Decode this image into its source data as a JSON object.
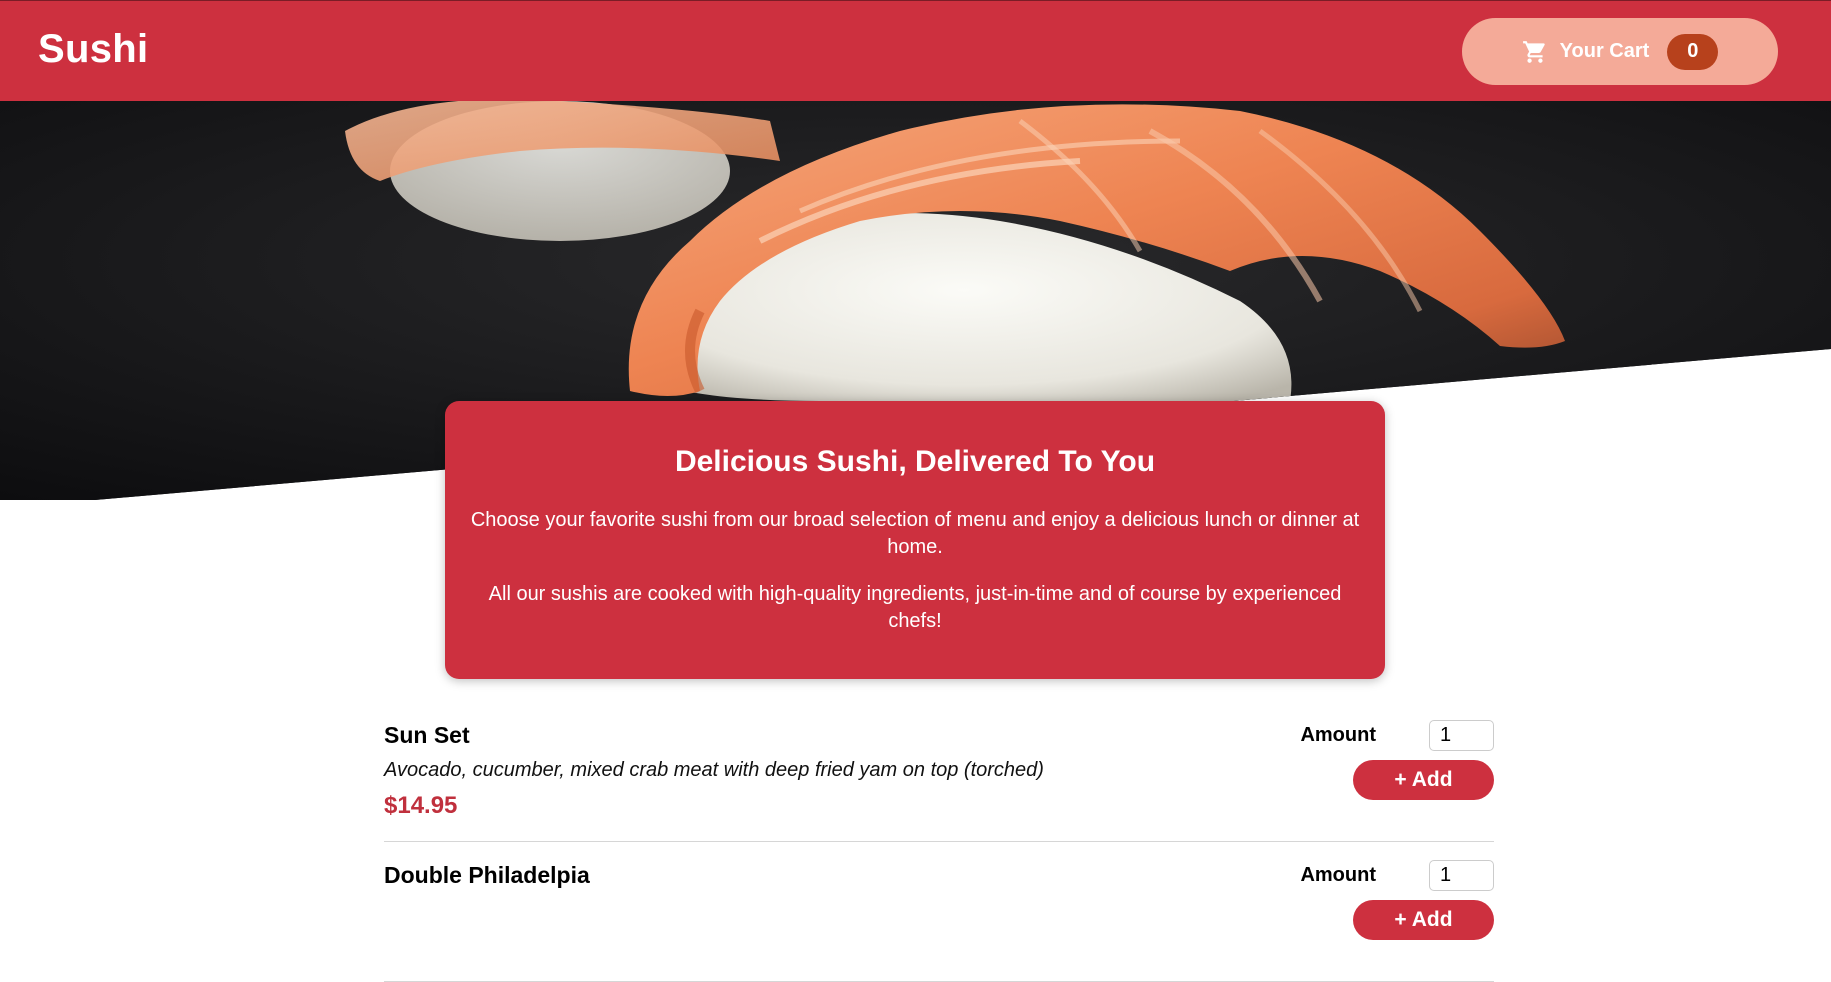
{
  "header": {
    "brand": "Sushi",
    "cart_label": "Your Cart",
    "cart_count": "0"
  },
  "hero": {
    "image": "salmon-nigiri-photo"
  },
  "intro": {
    "title": "Delicious Sushi, Delivered To You",
    "paragraph1": "Choose your favorite sushi from our broad selection of menu and enjoy a delicious lunch or dinner at home.",
    "paragraph2": "All our sushis are cooked with high-quality ingredients, just-in-time and of course by experienced chefs!"
  },
  "meals": [
    {
      "name": "Sun Set",
      "description": "Avocado, cucumber, mixed crab meat with deep fried yam on top (torched)",
      "price": "$14.95",
      "amount_label": "Amount",
      "amount_value": "1",
      "add_label": "+ Add"
    },
    {
      "name": "Double Philadelpia",
      "description": "",
      "price": "",
      "amount_label": "Amount",
      "amount_value": "1",
      "add_label": "+ Add"
    }
  ],
  "colors": {
    "primary": "#cd303f",
    "cart_button": "#f4aa98",
    "cart_badge": "#b7411c",
    "price": "#c0303d"
  },
  "icons": {
    "cart": "shopping-cart-icon"
  }
}
